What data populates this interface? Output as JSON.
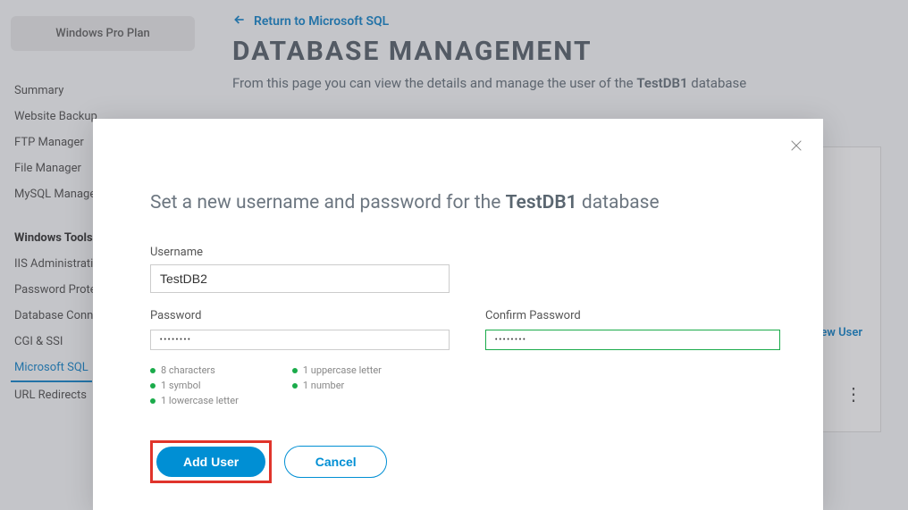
{
  "sidebar": {
    "plan_label": "Windows Pro Plan",
    "items_top": [
      "Summary",
      "Website Backup",
      "FTP Manager",
      "File Manager",
      "MySQL Manager"
    ],
    "section_heading": "Windows Tools",
    "items_tools": [
      "IIS Administration",
      "Password Protection",
      "Database Connection",
      "CGI & SSI",
      "Microsoft SQL",
      "URL Redirects"
    ],
    "active_tools_index": 4
  },
  "header": {
    "return_link": "Return to Microsoft SQL",
    "title": "DATABASE MANAGEMENT",
    "description_prefix": "From this page you can view the details and manage the user of the ",
    "description_dbname": "TestDB1",
    "description_suffix": " database"
  },
  "main_panel": {
    "add_new_user": "Add New User"
  },
  "modal": {
    "title_prefix": "Set a new username and password for the ",
    "title_db": "TestDB1",
    "title_suffix": " database",
    "username_label": "Username",
    "username_value": "TestDB2",
    "password_label": "Password",
    "password_value": "••••••••",
    "confirm_label": "Confirm Password",
    "confirm_value": "••••••••",
    "reqs_col1": [
      "8 characters",
      "1 symbol",
      "1 lowercase letter"
    ],
    "reqs_col2": [
      "1 uppercase letter",
      "1 number"
    ],
    "add_user_btn": "Add User",
    "cancel_btn": "Cancel"
  }
}
